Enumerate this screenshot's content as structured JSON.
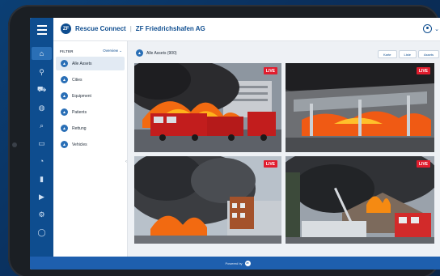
{
  "header": {
    "app_name": "Rescue Connect",
    "separator": "|",
    "organization": "ZF Friedrichshafen AG",
    "logo_text": "ZF"
  },
  "sidebar": {
    "title": "FILTER",
    "filter_label": "Overview",
    "items": [
      {
        "label": "Alle Assets",
        "active": true
      },
      {
        "label": "Cities",
        "active": false
      },
      {
        "label": "Equipment",
        "active": false
      },
      {
        "label": "Patients",
        "active": false
      },
      {
        "label": "Rettung",
        "active": false
      },
      {
        "label": "Vehicles",
        "active": false
      }
    ]
  },
  "content": {
    "breadcrumb": "Alle Assets (900)",
    "view_buttons": [
      "Karte",
      "Liste",
      "Assets"
    ]
  },
  "video_tiles": [
    {
      "badge": "LIVE"
    },
    {
      "badge": "LIVE"
    },
    {
      "badge": "LIVE"
    },
    {
      "badge": "LIVE"
    }
  ],
  "footer": {
    "text": "Powered by",
    "logo_text": "ZF"
  },
  "icons": {
    "rail": [
      "home-icon",
      "route-icon",
      "vehicle-icon",
      "globe-icon",
      "search-icon",
      "monitor-icon",
      "gauge-icon",
      "chart-icon",
      "video-icon",
      "settings-icon",
      "help-icon"
    ]
  },
  "colors": {
    "brand": "#0e4d8f",
    "accent": "#2a6fb6",
    "live": "#e11d2e",
    "footer": "#1e5fae"
  }
}
